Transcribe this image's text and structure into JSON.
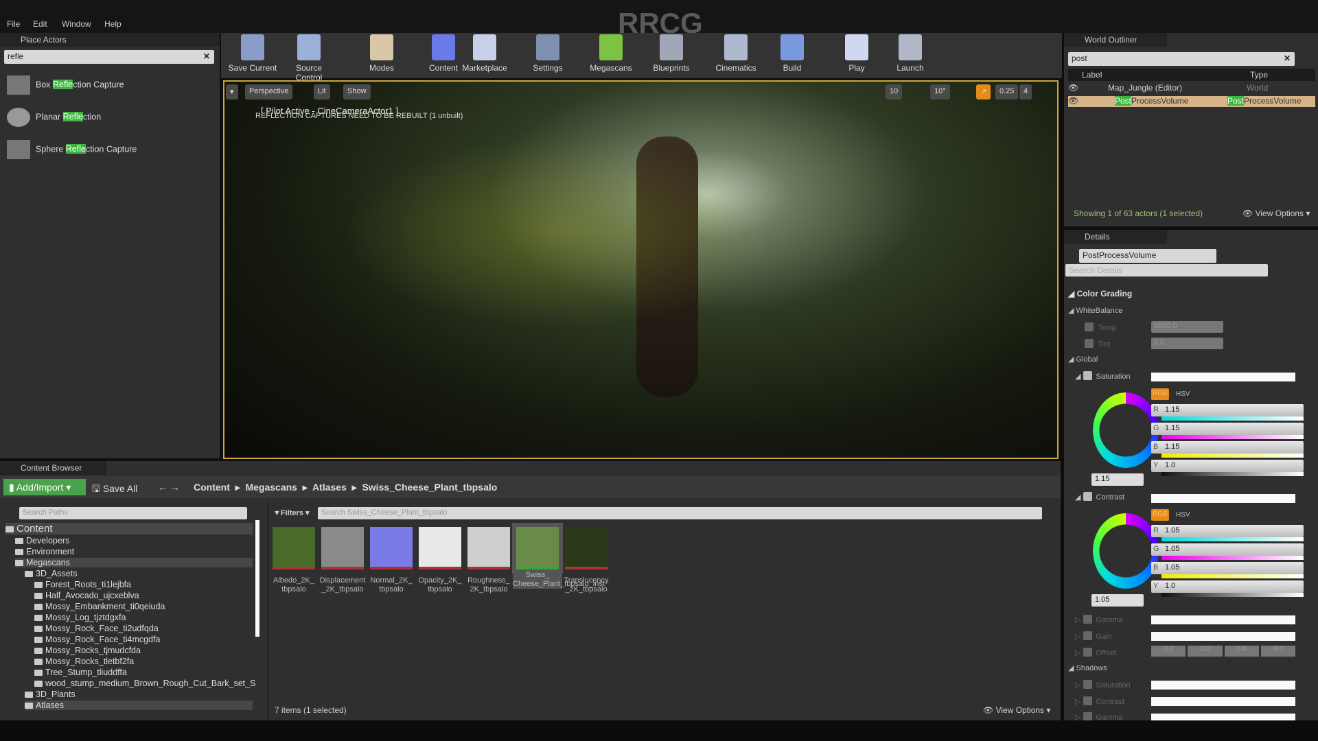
{
  "menu": [
    "File",
    "Edit",
    "Window",
    "Help"
  ],
  "watermark": "RRCG",
  "place_actors": {
    "title": "Place Actors",
    "search": "refle",
    "items": [
      {
        "pre": "Box ",
        "hl": "Refle",
        "post": "ction Capture"
      },
      {
        "pre": "Planar ",
        "hl": "Refle",
        "post": "ction"
      },
      {
        "pre": "Sphere ",
        "hl": "Refle",
        "post": "ction Capture"
      }
    ]
  },
  "toolbar": [
    "Save Current",
    "Source Control",
    "Modes",
    "Content",
    "Marketplace",
    "Settings",
    "Megascans",
    "Blueprints",
    "Cinematics",
    "Build",
    "Play",
    "Launch"
  ],
  "viewport": {
    "perspective": "Perspective",
    "lit": "Lit",
    "show": "Show",
    "pilot": "[ Pilot Active - CineCameraActor1 ]",
    "warning": "REFLECTION CAPTURES NEED TO BE REBUILT (1 unbuilt)",
    "grid": "10",
    "rot": "10°",
    "scale": "0.25",
    "cam": "4"
  },
  "outliner": {
    "title": "World Outliner",
    "search": "post",
    "col_label": "Label",
    "col_type": "Type",
    "rows": [
      {
        "label": "Map_Jungle (Editor)",
        "type": "World"
      },
      {
        "hl": "Post",
        "label": "ProcessVolume",
        "type_hl": "Post",
        "type": "ProcessVolume"
      }
    ],
    "status": "Showing 1 of 63 actors (1 selected)",
    "view_options": "View Options"
  },
  "details": {
    "title": "Details",
    "name": "PostProcessVolume",
    "search_placeholder": "Search Details",
    "color_grading": "Color Grading",
    "white_balance": "WhiteBalance",
    "temp_label": "Temp",
    "temp": "6500.0",
    "tint_label": "Tint",
    "tint": "0.0",
    "global": "Global",
    "saturation": "Saturation",
    "contrast": "Contrast",
    "rgb": "RGB",
    "hsv": "HSV",
    "sat": {
      "r": "1.15",
      "g": "1.15",
      "b": "1.15",
      "y": "1.0",
      "value": "1.15"
    },
    "con": {
      "r": "1.05",
      "g": "1.05",
      "b": "1.05",
      "y": "1.0",
      "value": "1.05"
    },
    "gamma": "Gamma",
    "gain": "Gain",
    "offset": "Offset",
    "offset_vals": [
      "0.0",
      "0.0",
      "0.0",
      "0.0"
    ],
    "shadows": "Shadows",
    "sh_items": [
      "Saturation",
      "Contrast",
      "Gamma"
    ]
  },
  "content_browser": {
    "title": "Content Browser",
    "add_import": "Add/Import",
    "save_all": "Save All",
    "breadcrumb": [
      "Content",
      "Megascans",
      "Atlases",
      "Swiss_Cheese_Plant_tbpsalo"
    ],
    "search_paths": "Search Paths",
    "filters": "Filters",
    "search_assets": "Search Swiss_Cheese_Plant_tbpsalo",
    "tree": [
      {
        "label": "Content",
        "lvl": 0
      },
      {
        "label": "Developers",
        "lvl": 1
      },
      {
        "label": "Environment",
        "lvl": 1
      },
      {
        "label": "Megascans",
        "lvl": 1
      },
      {
        "label": "3D_Assets",
        "lvl": 2
      },
      {
        "label": "Forest_Roots_ti1lejbfa",
        "lvl": 3
      },
      {
        "label": "Half_Avocado_ujcxeblva",
        "lvl": 3
      },
      {
        "label": "Mossy_Embankment_ti0qeiuda",
        "lvl": 3
      },
      {
        "label": "Mossy_Log_tjztdgxfa",
        "lvl": 3
      },
      {
        "label": "Mossy_Rock_Face_ti2udfqda",
        "lvl": 3
      },
      {
        "label": "Mossy_Rock_Face_ti4mcgdfa",
        "lvl": 3
      },
      {
        "label": "Mossy_Rocks_tjmudcfda",
        "lvl": 3
      },
      {
        "label": "Mossy_Rocks_tletbf2fa",
        "lvl": 3
      },
      {
        "label": "Tree_Stump_tliuddffa",
        "lvl": 3
      },
      {
        "label": "wood_stump_medium_Brown_Rough_Cut_Bark_set_S",
        "lvl": 3
      },
      {
        "label": "3D_Plants",
        "lvl": 2
      },
      {
        "label": "Atlases",
        "lvl": 2
      }
    ],
    "assets": [
      {
        "l1": "Albedo_2K_",
        "l2": "tbpsalo",
        "c": "#4a6a2a"
      },
      {
        "l1": "Displacement",
        "l2": "_2K_tbpsalo",
        "c": "#8a8a8a"
      },
      {
        "l1": "Normal_2K_",
        "l2": "tbpsalo",
        "c": "#7a7ae8"
      },
      {
        "l1": "Opacity_2K_",
        "l2": "tbpsalo",
        "c": "#e8e8e8"
      },
      {
        "l1": "Roughness_",
        "l2": "2K_tbpsalo",
        "c": "#cfcfcf"
      },
      {
        "l1": "Swiss_",
        "l2": "Cheese_Plant_tbpsalo_inst",
        "c": "#6a8a4a"
      },
      {
        "l1": "Translucency",
        "l2": "_2K_tbpsalo",
        "c": "#2a3a18"
      }
    ],
    "status": "7 items (1 selected)",
    "view_options": "View Options"
  },
  "colors": {
    "accent": "#e68a1a",
    "highlight": "#3db63d",
    "selected": "#d6b48a"
  }
}
